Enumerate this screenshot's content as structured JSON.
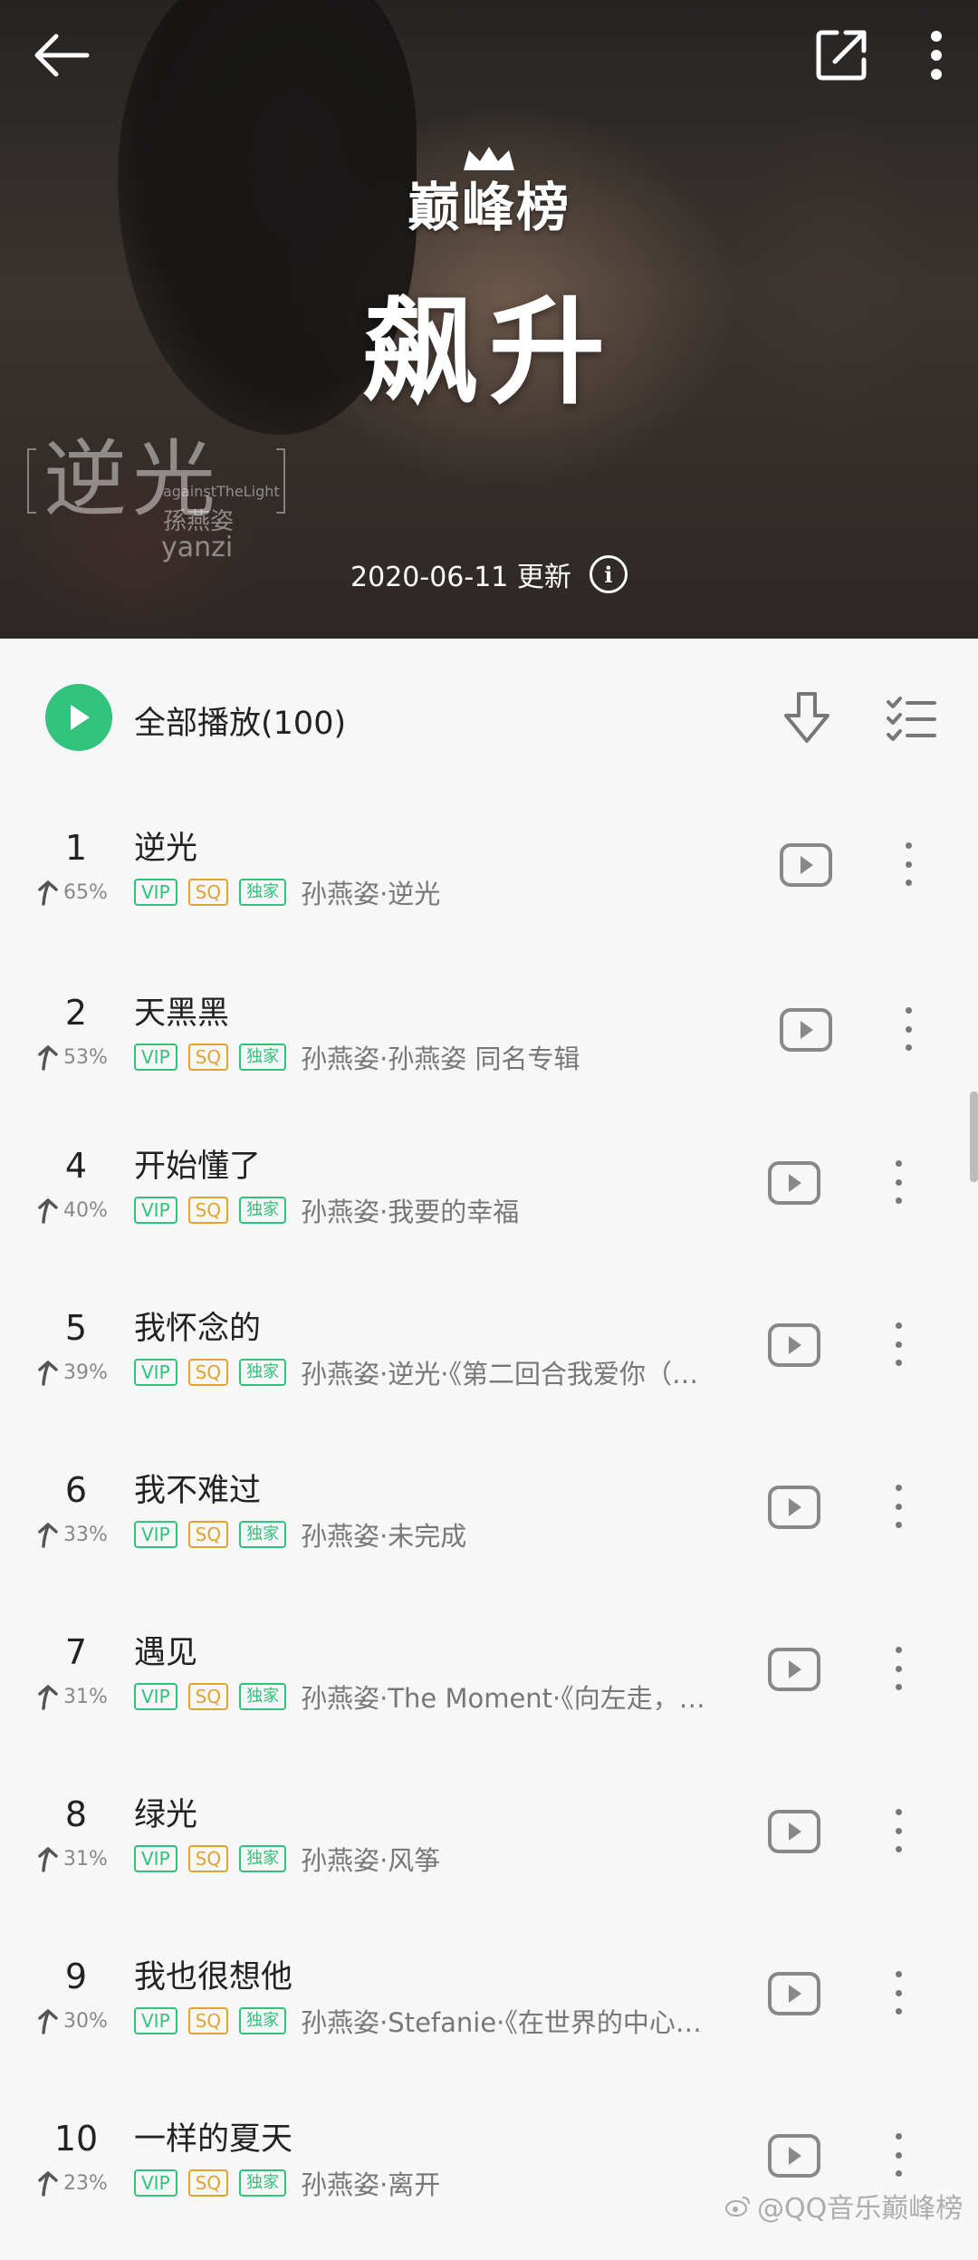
{
  "header": {
    "brand": "巅峰榜",
    "chart_title": "飙升",
    "update_text": "2020-06-11 更新",
    "info_icon": "i",
    "cover_art": {
      "album_title": "逆光",
      "english_title": "againstTheLight",
      "artist": "孫燕姿",
      "artist_latin": "yanzi"
    }
  },
  "toolbar": {
    "play_all_label": "全部播放(100)"
  },
  "songs": [
    {
      "rank": "1",
      "trend": "65%",
      "title": "逆光",
      "subtitle": "孙燕姿·逆光"
    },
    {
      "rank": "2",
      "trend": "53%",
      "title": "天黑黑",
      "subtitle": "孙燕姿·孙燕姿 同名专辑"
    },
    {
      "rank": "4",
      "trend": "40%",
      "title": "开始懂了",
      "subtitle": "孙燕姿·我要的幸福"
    },
    {
      "rank": "5",
      "trend": "39%",
      "title": "我怀念的",
      "subtitle": "孙燕姿·逆光·《第二回合我爱你（…"
    },
    {
      "rank": "6",
      "trend": "33%",
      "title": "我不难过",
      "subtitle": "孙燕姿·未完成"
    },
    {
      "rank": "7",
      "trend": "31%",
      "title": "遇见",
      "subtitle": "孙燕姿·The Moment·《向左走，…"
    },
    {
      "rank": "8",
      "trend": "31%",
      "title": "绿光",
      "subtitle": "孙燕姿·风筝"
    },
    {
      "rank": "9",
      "trend": "30%",
      "title": "我也很想他",
      "subtitle": "孙燕姿·Stefanie·《在世界的中心…"
    },
    {
      "rank": "10",
      "trend": "23%",
      "title": "一样的夏天",
      "subtitle": "孙燕姿·离开"
    }
  ],
  "tags": {
    "vip": "VIP",
    "sq": "SQ",
    "exclusive": "独家"
  },
  "watermark": "@QQ音乐巅峰榜",
  "colors": {
    "accent_green": "#31c27c",
    "sq_gold": "#e0a32e",
    "page_bg": "#f7f7f7"
  }
}
